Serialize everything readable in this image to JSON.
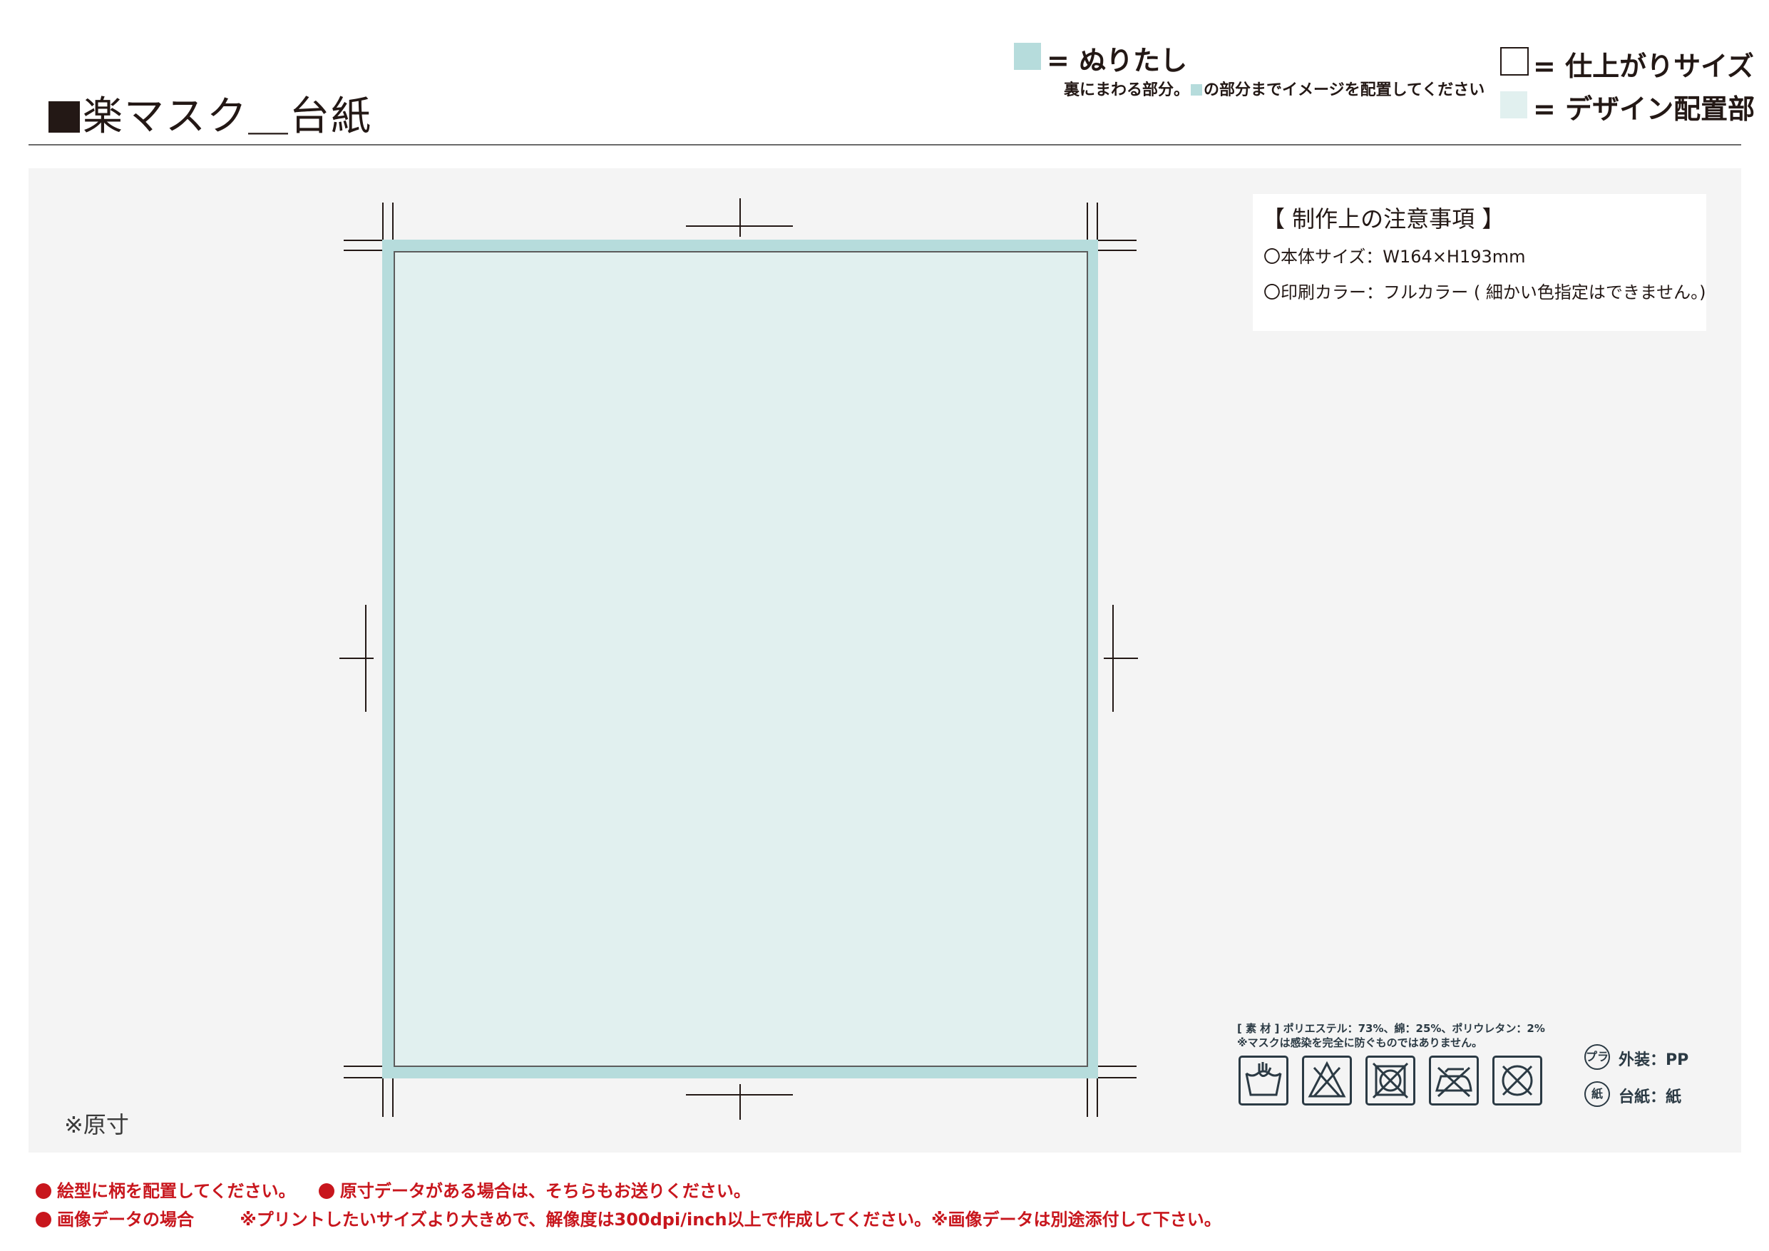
{
  "header": {
    "title": "楽マスク＿台紙"
  },
  "legend": {
    "bleed_label": "= ぬりたし",
    "bleed_note_before": "裏にまわる部分。",
    "bleed_note_after": "の部分までイメージを配置してください",
    "trim_label": "= 仕上がりサイズ",
    "design_label": "= デザイン配置部",
    "colors": {
      "bleed": "#b6dcdc",
      "design": "#e1f0ef"
    }
  },
  "notes": {
    "title": "【 制作上の注意事項 】",
    "size": "〇本体サイズ：W164×H193mm",
    "print_color": "〇印刷カラー：フルカラー ( 細かい色指定はできません。)"
  },
  "canvas": {
    "actual_size": "※原寸"
  },
  "product_label": {
    "material": "[ 素 材 ] ポリエステル：73%、綿：25%、ポリウレタン：2%",
    "disclaimer": "※マスクは感染を完全に防ぐものではありません。",
    "care_icons": [
      "hand-wash-icon",
      "no-bleach-icon",
      "no-tumble-dry-icon",
      "no-iron-icon",
      "no-dry-clean-icon"
    ],
    "recycle": [
      {
        "icon": "pla-recycle-icon",
        "mark": "プラ",
        "text": "外装：PP"
      },
      {
        "icon": "paper-recycle-icon",
        "mark": "紙",
        "text": "台紙：紙"
      }
    ]
  },
  "footer": {
    "line1_a": "絵型に柄を配置してください。",
    "line1_b": "原寸データがある場合は、そちらもお送りください。",
    "line2_a": "画像データの場合",
    "line2_b": "※プリントしたいサイズより大きめで、解像度は300dpi/inch以上で作成してください。※画像データは別途添付して下さい。"
  }
}
